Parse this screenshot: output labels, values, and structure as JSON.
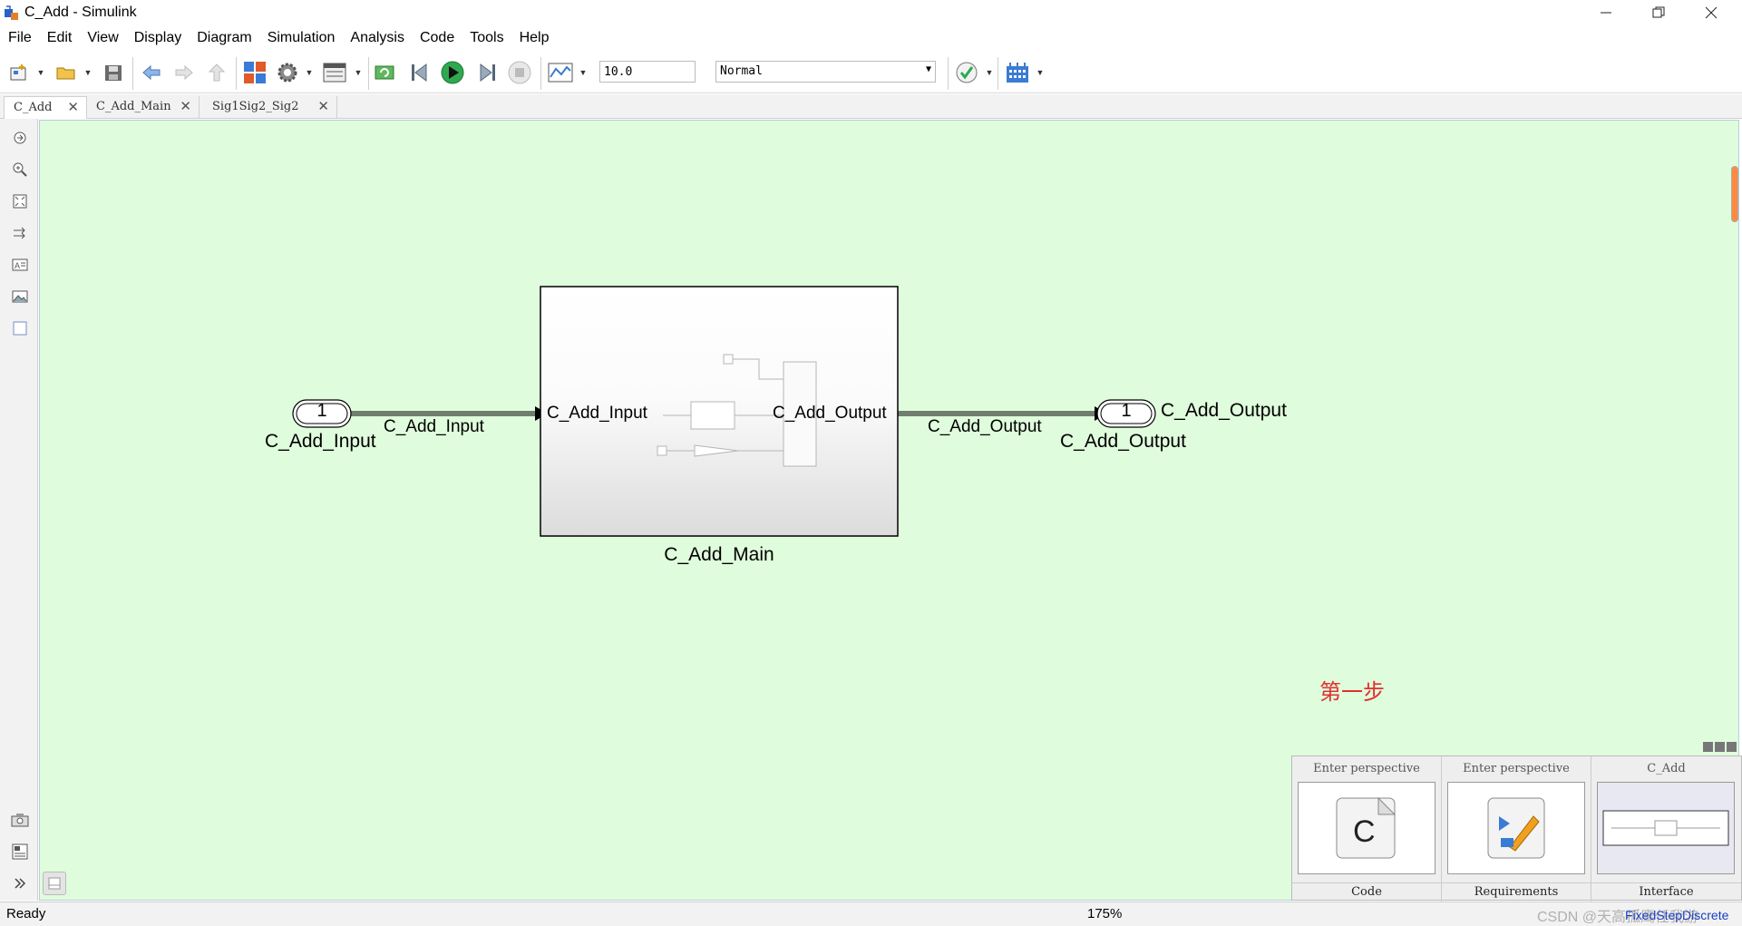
{
  "window": {
    "title": "C_Add - Simulink",
    "controls": [
      "minimize",
      "restore",
      "close"
    ]
  },
  "menu": [
    "File",
    "Edit",
    "View",
    "Display",
    "Diagram",
    "Simulation",
    "Analysis",
    "Code",
    "Tools",
    "Help"
  ],
  "toolbar": {
    "stop_time": "10.0",
    "sim_mode": "Normal",
    "icons": [
      "new-model-icon",
      "open-icon",
      "save-icon",
      "back-icon",
      "forward-icon",
      "up-icon",
      "library-browser-icon",
      "model-settings-icon",
      "model-explorer-icon",
      "update-diagram-icon",
      "step-back-icon",
      "run-icon",
      "step-forward-icon",
      "stop-icon",
      "data-inspector-icon",
      "model-advisor-icon",
      "build-icon"
    ]
  },
  "tabs": [
    {
      "label": "C_Add",
      "active": true
    },
    {
      "label": "C_Add_Main",
      "active": false
    },
    {
      "label": "Sig1Sig2_Sig2",
      "active": false
    }
  ],
  "diagram": {
    "inport": {
      "number": "1",
      "name": "C_Add_Input"
    },
    "input_signal": "C_Add_Input",
    "subsystem": {
      "name": "C_Add_Main",
      "in_port": "C_Add_Input",
      "out_port": "C_Add_Output"
    },
    "output_signal": "C_Add_Output",
    "outport": {
      "number": "1",
      "name": "C_Add_Output",
      "label_right": "C_Add_Output"
    },
    "annotation": "第一步",
    "background": "#dffcdc"
  },
  "perspectives": [
    {
      "header": "Enter perspective",
      "footer": "Code"
    },
    {
      "header": "Enter perspective",
      "footer": "Requirements"
    },
    {
      "header": "C_Add",
      "footer": "Interface"
    }
  ],
  "status": {
    "state": "Ready",
    "zoom": "175%",
    "solver": "FixedStepDiscrete",
    "watermark": "CSDN @天高孤鹰任我游"
  }
}
